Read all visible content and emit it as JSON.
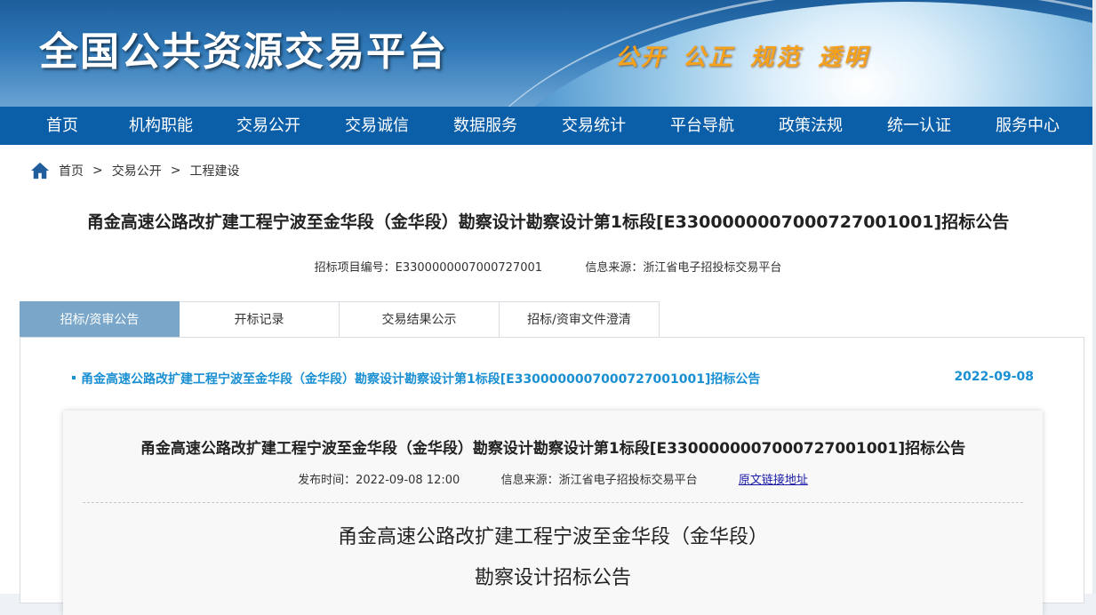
{
  "banner": {
    "title": "全国公共资源交易平台",
    "slogan": "公开 公正 规范 透明"
  },
  "nav": {
    "items": [
      {
        "label": "首页"
      },
      {
        "label": "机构职能"
      },
      {
        "label": "交易公开"
      },
      {
        "label": "交易诚信"
      },
      {
        "label": "数据服务"
      },
      {
        "label": "交易统计"
      },
      {
        "label": "平台导航"
      },
      {
        "label": "政策法规"
      },
      {
        "label": "统一认证"
      },
      {
        "label": "服务中心"
      }
    ]
  },
  "breadcrumb": {
    "items": [
      "首页",
      "交易公开",
      "工程建设"
    ],
    "separator": ">"
  },
  "page": {
    "title": "甬金高速公路改扩建工程宁波至金华段（金华段）勘察设计勘察设计第1标段[E3300000007000727001001]招标公告",
    "project_code_label": "招标项目编号：",
    "project_code": "E3300000007000727001",
    "source_label": "信息来源：",
    "source": "浙江省电子招投标交易平台"
  },
  "tabs": [
    {
      "label": "招标/资审公告",
      "active": true
    },
    {
      "label": "开标记录",
      "active": false
    },
    {
      "label": "交易结果公示",
      "active": false
    },
    {
      "label": "招标/资审文件澄清",
      "active": false
    }
  ],
  "notice": {
    "link_text": "甬金高速公路改扩建工程宁波至金华段（金华段）勘察设计勘察设计第1标段[E3300000007000727001001]招标公告",
    "date": "2022-09-08"
  },
  "document": {
    "title": "甬金高速公路改扩建工程宁波至金华段（金华段）勘察设计勘察设计第1标段[E3300000007000727001001]招标公告",
    "publish_label": "发布时间：",
    "publish_time": "2022-09-08 12:00",
    "source_label": "信息来源：",
    "source": "浙江省电子招投标交易平台",
    "original_link": "原文链接地址",
    "body_line1": "甬金高速公路改扩建工程宁波至金华段（金华段）",
    "body_line2": "勘察设计招标公告"
  },
  "colors": {
    "nav_bg": "#0b5ea8",
    "tab_active_bg": "#7aa7c9",
    "link_blue": "#1a8fd2",
    "slogan_orange": "#f5a11b"
  }
}
